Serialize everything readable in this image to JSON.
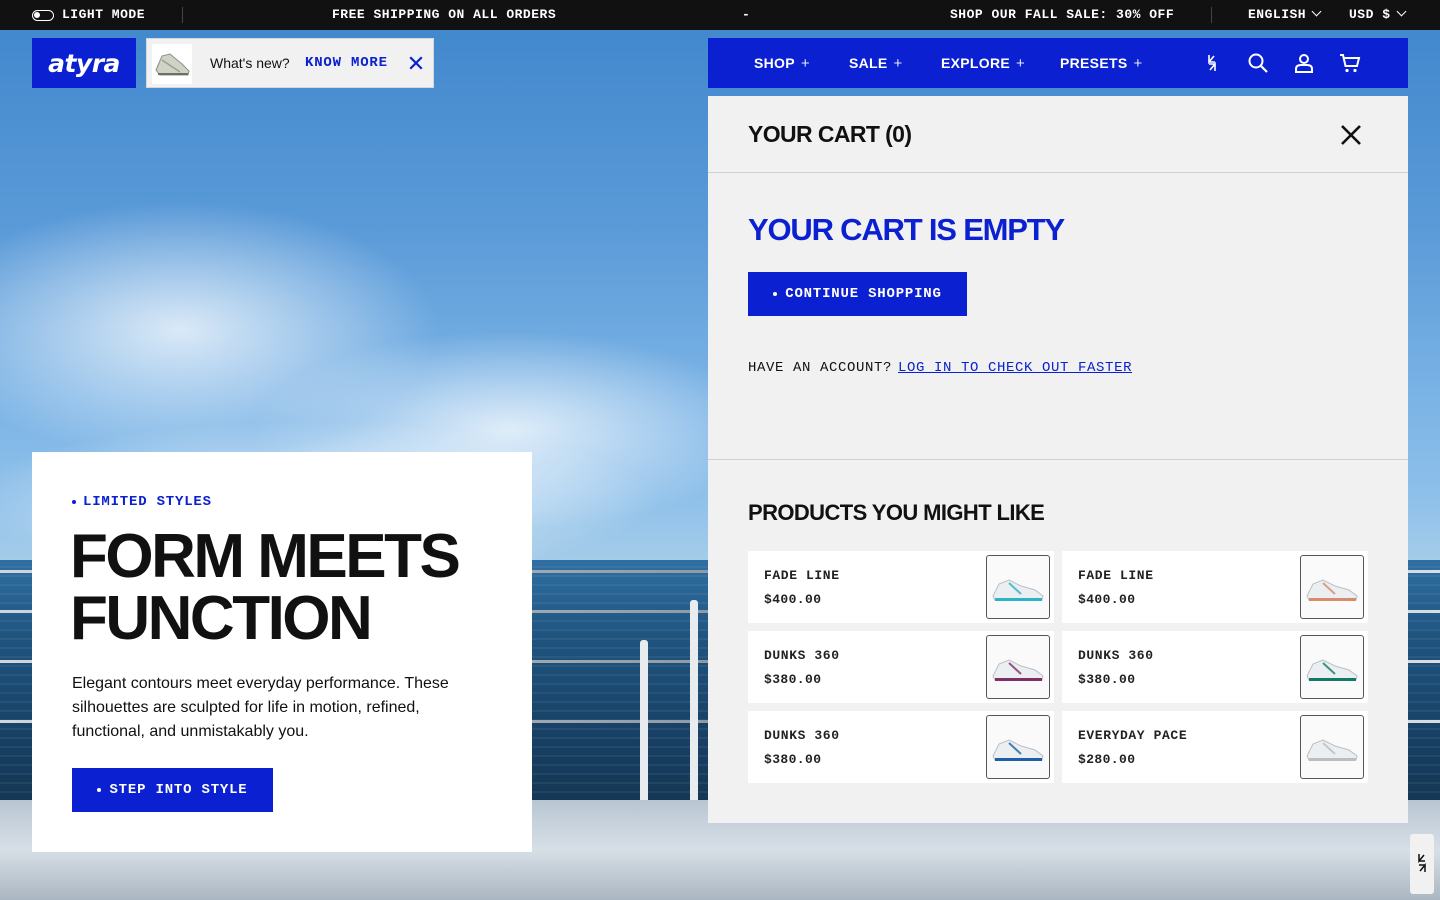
{
  "topbar": {
    "mode_label": "LIGHT MODE",
    "announcement": "FREE SHIPPING ON ALL ORDERS",
    "separator": "-",
    "sale": "SHOP OUR FALL SALE: 30% OFF",
    "language": "ENGLISH",
    "currency": "USD $"
  },
  "brand": {
    "logo_text": "atyra"
  },
  "whats_new": {
    "label": "What's new?",
    "link": "KNOW MORE"
  },
  "nav": {
    "items": [
      {
        "label": "SHOP"
      },
      {
        "label": "SALE"
      },
      {
        "label": "EXPLORE"
      },
      {
        "label": "PRESETS"
      }
    ],
    "plus_glyph": "+",
    "icons": [
      "brand-mark-icon",
      "search-icon",
      "account-icon",
      "cart-icon"
    ]
  },
  "cart": {
    "title": "YOUR CART (0)",
    "empty_title": "YOUR CART IS EMPTY",
    "continue_button": "CONTINUE SHOPPING",
    "account_prompt": "HAVE AN ACCOUNT?",
    "login_link": "LOG IN TO CHECK OUT FASTER",
    "recommend_title": "PRODUCTS YOU MIGHT LIKE",
    "products": [
      {
        "name": "FADE LINE",
        "price": "$400.00",
        "accent": "#2ab3c9"
      },
      {
        "name": "FADE LINE",
        "price": "$400.00",
        "accent": "#d98a6a"
      },
      {
        "name": "DUNKS 360",
        "price": "$380.00",
        "accent": "#7d2f66"
      },
      {
        "name": "DUNKS 360",
        "price": "$380.00",
        "accent": "#127a63"
      },
      {
        "name": "DUNKS 360",
        "price": "$380.00",
        "accent": "#1f5fa8"
      },
      {
        "name": "EVERYDAY PACE",
        "price": "$280.00",
        "accent": "#bdbdbd"
      }
    ]
  },
  "hero": {
    "eyebrow": "LIMITED STYLES",
    "headline_line1": "FORM MEETS",
    "headline_line2": "FUNCTION",
    "body": "Elegant contours meet everyday performance. These silhouettes are sculpted for life in motion, refined, functional, and unmistakably you.",
    "cta": "STEP INTO STYLE"
  },
  "colors": {
    "brand_blue": "#0b20d0",
    "topbar_bg": "#111111",
    "panel_bg": "#f1f1f1"
  }
}
